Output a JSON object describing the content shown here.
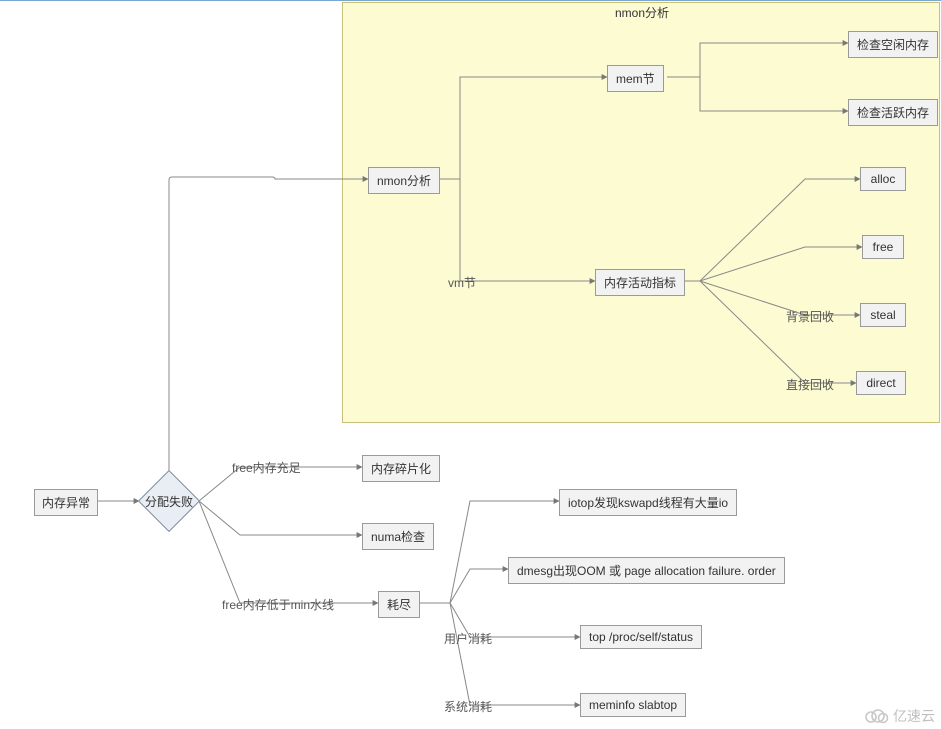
{
  "diagram": {
    "group_title": "nmon分析",
    "root": "内存异常",
    "decision": "分配失败",
    "branches": {
      "nmon": {
        "label": "nmon分析",
        "children": {
          "mem": {
            "label": "mem节",
            "leaves": {
              "idle": "检查空闲内存",
              "active": "检查活跃内存"
            }
          },
          "vm": {
            "edge": "vm节",
            "label": "内存活动指标",
            "leaves": {
              "alloc": "alloc",
              "free": "free",
              "steal": "steal",
              "direct": "direct"
            },
            "edge_labels": {
              "steal": "背景回收",
              "direct": "直接回收"
            }
          }
        }
      },
      "free_enough": {
        "edge": "free内存充足",
        "nodes": {
          "frag": "内存碎片化",
          "numa": "numa检查"
        }
      },
      "free_low": {
        "edge": "free内存低于min水线",
        "label": "耗尽",
        "leaves": {
          "iotop": "iotop发现kswapd线程有大量io",
          "dmesg": "dmesg出现OOM 或 page allocation failure. order",
          "top": "top /proc/self/status",
          "meminfo": "meminfo slabtop"
        },
        "edge_labels": {
          "top": "用户消耗",
          "meminfo": "系统消耗"
        }
      }
    }
  },
  "watermark": "亿速云"
}
